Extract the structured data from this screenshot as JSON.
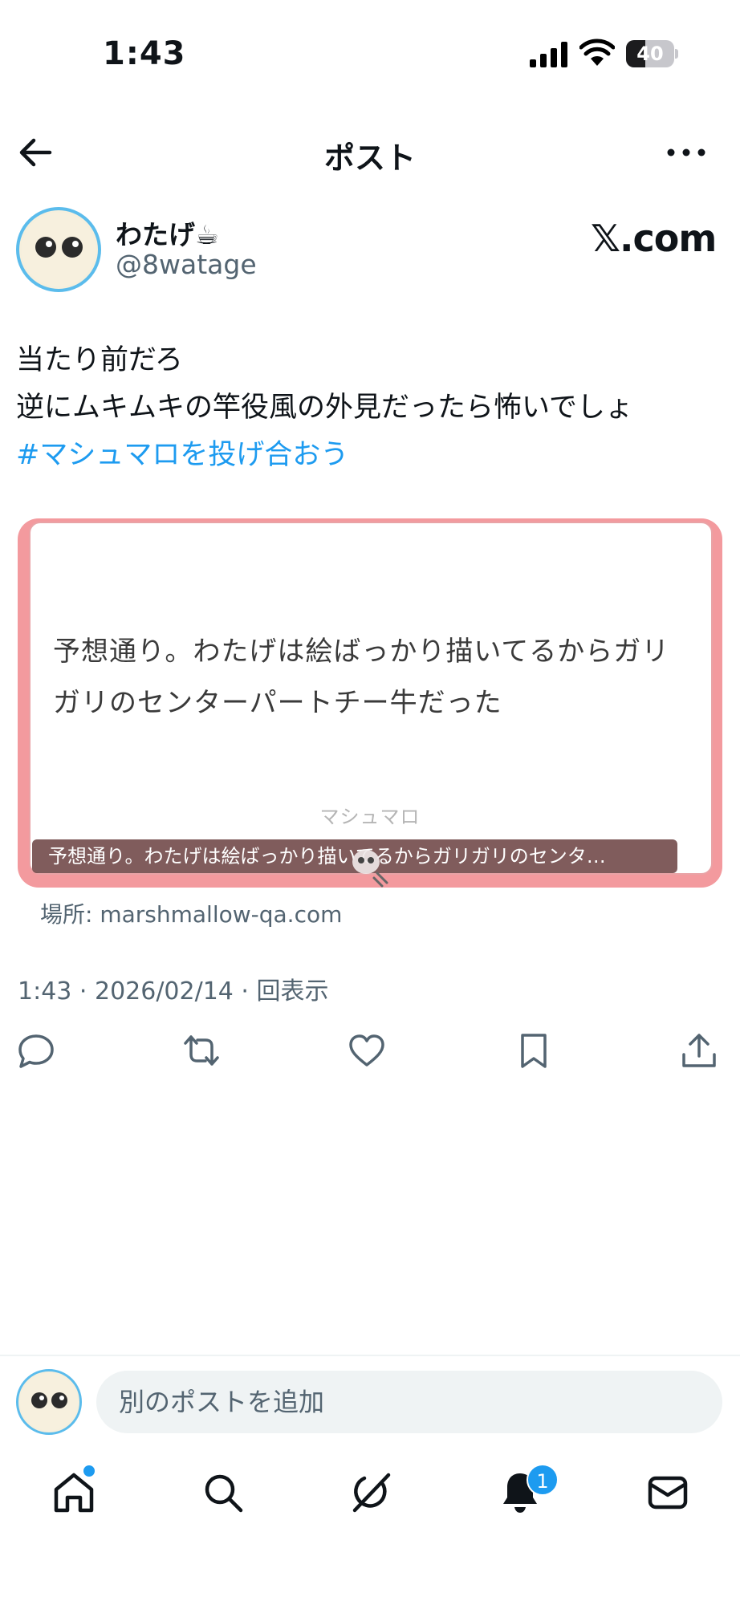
{
  "status": {
    "time": "1:43",
    "battery": "40",
    "battery_level": 0.4
  },
  "nav": {
    "title": "ポスト"
  },
  "author": {
    "name": "わたげ☕",
    "handle": "@8watage"
  },
  "source_label": "𝕏.com",
  "post": {
    "lines": [
      "当たり前だろ",
      "逆にムキムキの竿役風の外見だったら怖いでしょ"
    ],
    "hashtag": "#マシュマロを投げ合おう"
  },
  "card": {
    "text": "予想通り。わたげは絵ばっかり描いてるからガリガリのセンターパートチー牛だった",
    "brand": "マシュマロ",
    "caption": "予想通り。わたげは絵ばっかり描いてるからガリガリのセンタ…",
    "domain": "場所: marshmallow-qa.com"
  },
  "meta": "1:43 · 2026/02/14 · 回表示",
  "actions": [
    "reply-icon",
    "repost-icon",
    "like-icon",
    "bookmark-icon",
    "share-icon"
  ],
  "reply_bar": {
    "placeholder": "別のポストを追加"
  },
  "tabbar": {
    "tabs": [
      "home-icon",
      "search-icon",
      "grok-icon",
      "notifications-icon",
      "messages-icon"
    ],
    "notification_count": "1"
  },
  "colors": {
    "accent": "#1d9bf0",
    "card_border": "#f39a9e",
    "secondary_text": "#536471"
  }
}
